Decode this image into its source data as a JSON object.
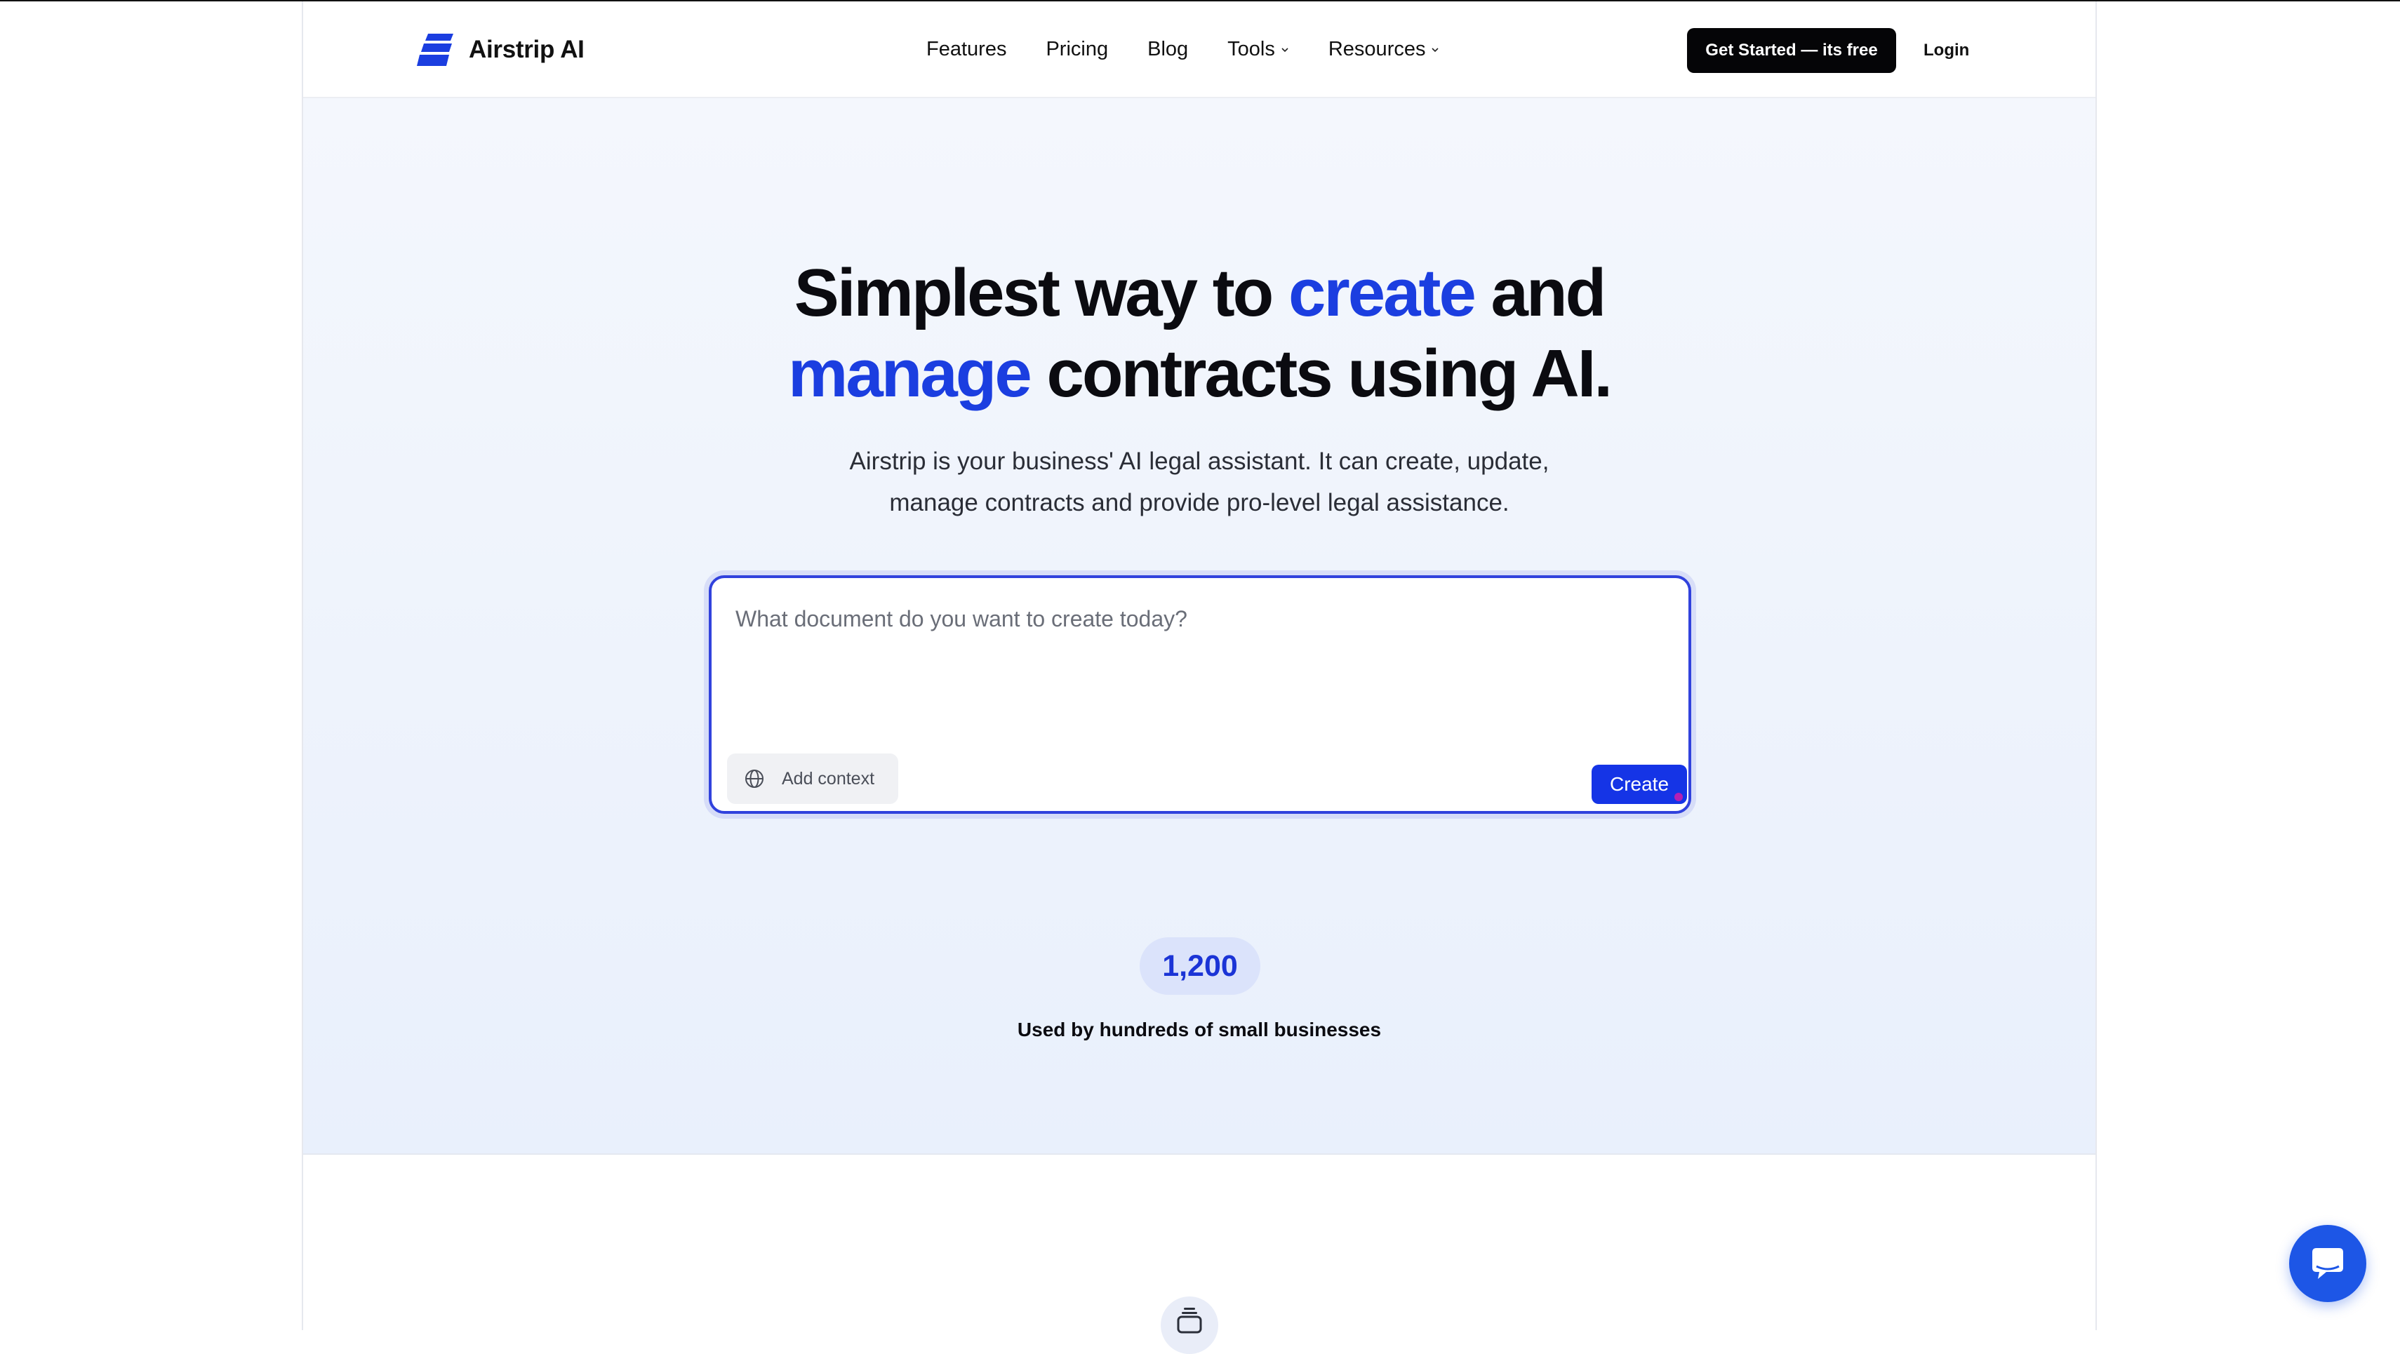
{
  "header": {
    "brand": "Airstrip AI",
    "nav": [
      {
        "label": "Features"
      },
      {
        "label": "Pricing"
      },
      {
        "label": "Blog"
      },
      {
        "label": "Tools"
      },
      {
        "label": "Resources"
      }
    ],
    "cta_label": "Get Started — its free",
    "login_label": "Login"
  },
  "hero": {
    "headline_part1": "Simplest way to ",
    "headline_accent1": "create",
    "headline_part2": " and",
    "headline_accent2": "manage",
    "headline_part3": " contracts using AI.",
    "subtitle_line1": "Airstrip is your business' AI legal assistant. It can create, update,",
    "subtitle_line2": "manage contracts and provide pro-level legal assistance.",
    "prompt_placeholder": "What document do you want to create today?",
    "add_context_label": "Add context",
    "create_label": "Create",
    "stat_value": "1,200",
    "stat_label": "Used by hundreds of small businesses"
  },
  "icons": {
    "logo": "airstrip-logo-icon",
    "globe": "globe-icon",
    "chevron": "chevron-down-icon",
    "chat": "chat-icon",
    "section": "stack-icon"
  },
  "colors": {
    "accent": "#1b3ee0",
    "cta_bg": "#050507",
    "create_bg": "#1534e6",
    "chat_bg": "#1d56e6",
    "stat_bg": "#dbe3fb"
  }
}
